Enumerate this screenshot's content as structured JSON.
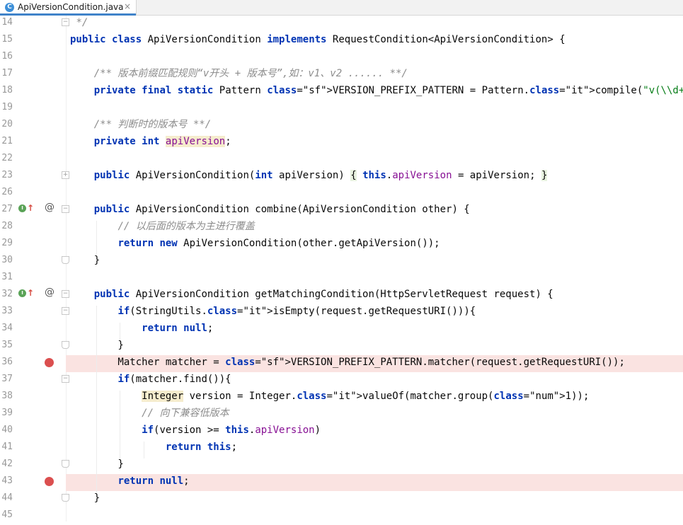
{
  "tab": {
    "icon_letter": "C",
    "title": "ApiVersionCondition.java",
    "close_glyph": "×"
  },
  "lines": [
    {
      "n": "14",
      "text": " */"
    },
    {
      "n": "15",
      "text": "public class ApiVersionCondition implements RequestCondition<ApiVersionCondition> {"
    },
    {
      "n": "16",
      "text": ""
    },
    {
      "n": "17",
      "text": "    /** 版本前缀匹配规则“v开头 + 版本号”,如：v1、v2 ...... **/"
    },
    {
      "n": "18",
      "text": "    private final static Pattern VERSION_PREFIX_PATTERN = Pattern.compile(\"v(\\\\d+)/\");"
    },
    {
      "n": "19",
      "text": ""
    },
    {
      "n": "20",
      "text": "    /** 判断时的版本号 **/"
    },
    {
      "n": "21",
      "text": "    private int apiVersion;"
    },
    {
      "n": "22",
      "text": ""
    },
    {
      "n": "23",
      "text": "    public ApiVersionCondition(int apiVersion) { this.apiVersion = apiVersion; }"
    },
    {
      "n": "26",
      "text": ""
    },
    {
      "n": "27",
      "text": "    public ApiVersionCondition combine(ApiVersionCondition other) {"
    },
    {
      "n": "28",
      "text": "        // 以后面的版本为主进行覆盖"
    },
    {
      "n": "29",
      "text": "        return new ApiVersionCondition(other.getApiVersion());"
    },
    {
      "n": "30",
      "text": "    }"
    },
    {
      "n": "31",
      "text": ""
    },
    {
      "n": "32",
      "text": "    public ApiVersionCondition getMatchingCondition(HttpServletRequest request) {"
    },
    {
      "n": "33",
      "text": "        if(StringUtils.isEmpty(request.getRequestURI())){"
    },
    {
      "n": "34",
      "text": "            return null;"
    },
    {
      "n": "35",
      "text": "        }"
    },
    {
      "n": "36",
      "text": "        Matcher matcher = VERSION_PREFIX_PATTERN.matcher(request.getRequestURI());"
    },
    {
      "n": "37",
      "text": "        if(matcher.find()){"
    },
    {
      "n": "38",
      "text": "            Integer version = Integer.valueOf(matcher.group(1));"
    },
    {
      "n": "39",
      "text": "            // 向下兼容低版本"
    },
    {
      "n": "40",
      "text": "            if(version >= this.apiVersion)"
    },
    {
      "n": "41",
      "text": "                return this;"
    },
    {
      "n": "42",
      "text": "        }"
    },
    {
      "n": "43",
      "text": "        return null;"
    },
    {
      "n": "44",
      "text": "    }"
    },
    {
      "n": "45",
      "text": ""
    }
  ],
  "gutter_markers": {
    "implements_icon_letter": "I",
    "implements_arrow": "↑",
    "override_glyph": "@",
    "fold_expand_glyph": "+",
    "fold_collapse_glyph": "−"
  },
  "colors": {
    "keyword": "#0033b3",
    "comment": "#8c8c8c",
    "string": "#067d17",
    "field": "#871094",
    "number": "#1750eb",
    "breakpoint": "#db4f4f",
    "breakpoint_line": "#fae3e1",
    "tab_accent": "#4083c9"
  }
}
